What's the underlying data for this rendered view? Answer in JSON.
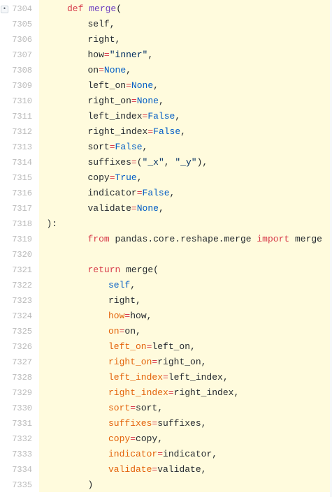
{
  "expand_glyph": "•",
  "lines": [
    {
      "number": "7304",
      "indent": 0,
      "tokens": [
        {
          "t": "def",
          "c": "kw"
        },
        {
          "t": " "
        },
        {
          "t": "merge",
          "c": "fn"
        },
        {
          "t": "("
        }
      ]
    },
    {
      "number": "7305",
      "indent": 1,
      "tokens": [
        {
          "t": "self,"
        }
      ]
    },
    {
      "number": "7306",
      "indent": 1,
      "tokens": [
        {
          "t": "right,"
        }
      ]
    },
    {
      "number": "7307",
      "indent": 1,
      "tokens": [
        {
          "t": "how"
        },
        {
          "t": "=",
          "c": "op"
        },
        {
          "t": "\"inner\"",
          "c": "str"
        },
        {
          "t": ","
        }
      ]
    },
    {
      "number": "7308",
      "indent": 1,
      "tokens": [
        {
          "t": "on"
        },
        {
          "t": "=",
          "c": "op"
        },
        {
          "t": "None",
          "c": "const"
        },
        {
          "t": ","
        }
      ]
    },
    {
      "number": "7309",
      "indent": 1,
      "tokens": [
        {
          "t": "left_on"
        },
        {
          "t": "=",
          "c": "op"
        },
        {
          "t": "None",
          "c": "const"
        },
        {
          "t": ","
        }
      ]
    },
    {
      "number": "7310",
      "indent": 1,
      "tokens": [
        {
          "t": "right_on"
        },
        {
          "t": "=",
          "c": "op"
        },
        {
          "t": "None",
          "c": "const"
        },
        {
          "t": ","
        }
      ]
    },
    {
      "number": "7311",
      "indent": 1,
      "tokens": [
        {
          "t": "left_index"
        },
        {
          "t": "=",
          "c": "op"
        },
        {
          "t": "False",
          "c": "const"
        },
        {
          "t": ","
        }
      ]
    },
    {
      "number": "7312",
      "indent": 1,
      "tokens": [
        {
          "t": "right_index"
        },
        {
          "t": "=",
          "c": "op"
        },
        {
          "t": "False",
          "c": "const"
        },
        {
          "t": ","
        }
      ]
    },
    {
      "number": "7313",
      "indent": 1,
      "tokens": [
        {
          "t": "sort"
        },
        {
          "t": "=",
          "c": "op"
        },
        {
          "t": "False",
          "c": "const"
        },
        {
          "t": ","
        }
      ]
    },
    {
      "number": "7314",
      "indent": 1,
      "tokens": [
        {
          "t": "suffixes"
        },
        {
          "t": "=",
          "c": "op"
        },
        {
          "t": "("
        },
        {
          "t": "\"_x\"",
          "c": "str"
        },
        {
          "t": ", "
        },
        {
          "t": "\"_y\"",
          "c": "str"
        },
        {
          "t": "),"
        }
      ]
    },
    {
      "number": "7315",
      "indent": 1,
      "tokens": [
        {
          "t": "copy"
        },
        {
          "t": "=",
          "c": "op"
        },
        {
          "t": "True",
          "c": "const"
        },
        {
          "t": ","
        }
      ]
    },
    {
      "number": "7316",
      "indent": 1,
      "tokens": [
        {
          "t": "indicator"
        },
        {
          "t": "=",
          "c": "op"
        },
        {
          "t": "False",
          "c": "const"
        },
        {
          "t": ","
        }
      ]
    },
    {
      "number": "7317",
      "indent": 1,
      "tokens": [
        {
          "t": "validate"
        },
        {
          "t": "=",
          "c": "op"
        },
        {
          "t": "None",
          "c": "const"
        },
        {
          "t": ","
        }
      ]
    },
    {
      "number": "7318",
      "indent": -1,
      "tokens": [
        {
          "t": "):"
        }
      ]
    },
    {
      "number": "7319",
      "indent": 1,
      "tokens": [
        {
          "t": "from",
          "c": "kw"
        },
        {
          "t": " pandas.core.reshape.merge "
        },
        {
          "t": "import",
          "c": "kw"
        },
        {
          "t": " merge"
        }
      ]
    },
    {
      "number": "7320",
      "indent": 0,
      "tokens": []
    },
    {
      "number": "7321",
      "indent": 1,
      "tokens": [
        {
          "t": "return",
          "c": "kw"
        },
        {
          "t": " merge("
        }
      ]
    },
    {
      "number": "7322",
      "indent": 2,
      "tokens": [
        {
          "t": "self",
          "c": "const"
        },
        {
          "t": ","
        }
      ]
    },
    {
      "number": "7323",
      "indent": 2,
      "tokens": [
        {
          "t": "right,"
        }
      ]
    },
    {
      "number": "7324",
      "indent": 2,
      "tokens": [
        {
          "t": "how",
          "c": "param"
        },
        {
          "t": "=",
          "c": "op"
        },
        {
          "t": "how,"
        }
      ]
    },
    {
      "number": "7325",
      "indent": 2,
      "tokens": [
        {
          "t": "on",
          "c": "param"
        },
        {
          "t": "=",
          "c": "op"
        },
        {
          "t": "on,"
        }
      ]
    },
    {
      "number": "7326",
      "indent": 2,
      "tokens": [
        {
          "t": "left_on",
          "c": "param"
        },
        {
          "t": "=",
          "c": "op"
        },
        {
          "t": "left_on,"
        }
      ]
    },
    {
      "number": "7327",
      "indent": 2,
      "tokens": [
        {
          "t": "right_on",
          "c": "param"
        },
        {
          "t": "=",
          "c": "op"
        },
        {
          "t": "right_on,"
        }
      ]
    },
    {
      "number": "7328",
      "indent": 2,
      "tokens": [
        {
          "t": "left_index",
          "c": "param"
        },
        {
          "t": "=",
          "c": "op"
        },
        {
          "t": "left_index,"
        }
      ]
    },
    {
      "number": "7329",
      "indent": 2,
      "tokens": [
        {
          "t": "right_index",
          "c": "param"
        },
        {
          "t": "=",
          "c": "op"
        },
        {
          "t": "right_index,"
        }
      ]
    },
    {
      "number": "7330",
      "indent": 2,
      "tokens": [
        {
          "t": "sort",
          "c": "param"
        },
        {
          "t": "=",
          "c": "op"
        },
        {
          "t": "sort,"
        }
      ]
    },
    {
      "number": "7331",
      "indent": 2,
      "tokens": [
        {
          "t": "suffixes",
          "c": "param"
        },
        {
          "t": "=",
          "c": "op"
        },
        {
          "t": "suffixes,"
        }
      ]
    },
    {
      "number": "7332",
      "indent": 2,
      "tokens": [
        {
          "t": "copy",
          "c": "param"
        },
        {
          "t": "=",
          "c": "op"
        },
        {
          "t": "copy,"
        }
      ]
    },
    {
      "number": "7333",
      "indent": 2,
      "tokens": [
        {
          "t": "indicator",
          "c": "param"
        },
        {
          "t": "=",
          "c": "op"
        },
        {
          "t": "indicator,"
        }
      ]
    },
    {
      "number": "7334",
      "indent": 2,
      "tokens": [
        {
          "t": "validate",
          "c": "param"
        },
        {
          "t": "=",
          "c": "op"
        },
        {
          "t": "validate,"
        }
      ]
    },
    {
      "number": "7335",
      "indent": 1,
      "tokens": [
        {
          "t": ")"
        }
      ]
    }
  ]
}
